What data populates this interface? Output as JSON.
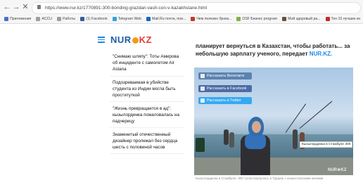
{
  "browser": {
    "url": "https://www.nur.kz/1770891-300-bonding-grazdan-vash-con-v-kazakhstane.html",
    "bookmarks": [
      {
        "label": "Приложения",
        "color": "#4a6fd1"
      },
      {
        "label": "ACCU",
        "color": "#9e9e9e"
      },
      {
        "label": "Работы",
        "color": "#9e9e9e"
      },
      {
        "label": "(1) Facebook",
        "color": "#3b5998"
      },
      {
        "label": "Telegram Web",
        "color": "#2ca5e0"
      },
      {
        "label": "Mail.Ru почта, пои...",
        "color": "#1565c0"
      },
      {
        "label": "Чем полезен брокк...",
        "color": "#c0392b"
      },
      {
        "label": "OSF Бизнес program",
        "color": "#7cb342"
      },
      {
        "label": "Мой здоровый ра...",
        "color": "#6d4c41"
      },
      {
        "label": "Топ 10 лучших кн",
        "color": "#c62828"
      }
    ]
  },
  "site": {
    "logo_left": "NUR",
    "logo_right": "KZ"
  },
  "sidebar": {
    "items": [
      "\"Снимаю шляпу\": Тоты Амирова об инциденте с самолетом Air Astana",
      "Подозреваемая в убийстве студента из Индии могла быть проституткой",
      "\"Жизнь превращается в ад\": кызылординка пожаловалась на падчерицу",
      "Знаменитый отечественный дизайнер пролежал без сердца шесть с половиной часов"
    ]
  },
  "article": {
    "line1": "планирует вернуться в Казахстан, чтобы работать... за",
    "line2_prefix": "небольшую зарплату ученого, передает",
    "brand": "NUR.KZ.",
    "share_vk": "Рассказать Вконтакте",
    "share_fb": "Рассказать в Facebook",
    "share_tw": "Рассказать в Twitter",
    "tooltip": "Кызылординка в Стамбуле 300",
    "watermark": "NUR★KZ",
    "caption": "Кызылординка в Стамбуле. 300 тусов вернулась в Турцию с казахстанскими женами"
  }
}
